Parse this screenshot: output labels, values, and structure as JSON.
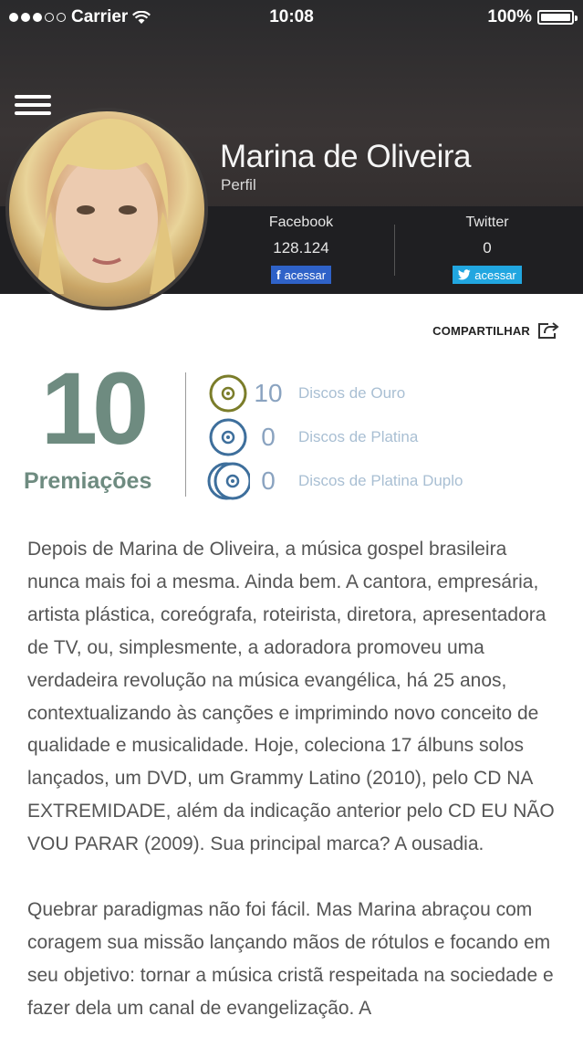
{
  "status_bar": {
    "carrier": "Carrier",
    "time": "10:08",
    "battery": "100%"
  },
  "profile": {
    "name": "Marina de Oliveira",
    "subtitle": "Perfil"
  },
  "social": {
    "facebook": {
      "label": "Facebook",
      "count": "128.124",
      "button": "acessar",
      "color": "#2f62c8"
    },
    "twitter": {
      "label": "Twitter",
      "count": "0",
      "button": "acessar",
      "color": "#21a6e0"
    }
  },
  "share_label": "COMPARTILHAR",
  "awards": {
    "total": "10",
    "label": "Premiações",
    "items": [
      {
        "count": "10",
        "label": "Discos de Ouro",
        "icon": "gold-disc-icon",
        "color": "#7b7d2a"
      },
      {
        "count": "0",
        "label": "Discos de Platina",
        "icon": "platinum-disc-icon",
        "color": "#3e6f9c"
      },
      {
        "count": "0",
        "label": "Discos de Platina Duplo",
        "icon": "double-platinum-disc-icon",
        "color": "#3e6f9c"
      }
    ]
  },
  "bio": {
    "paragraph1": "Depois de Marina de Oliveira, a música gospel brasileira nunca mais foi a mesma. Ainda bem. A cantora, empresária, artista plástica, coreógrafa, roteirista, diretora, apresentadora de TV, ou, simplesmente, a adoradora promoveu uma verdadeira revolução na música evangélica, há 25 anos, contextualizando às canções e imprimindo novo conceito de qualidade e musicalidade. Hoje, coleciona 17 álbuns solos lançados, um DVD, um Grammy Latino (2010), pelo CD NA EXTREMIDADE, além da indicação anterior pelo CD EU NÃO VOU PARAR (2009). Sua principal marca? A ousadia.",
    "paragraph2": "Quebrar paradigmas não foi fácil. Mas Marina abraçou com coragem sua missão lançando mãos de rótulos e focando em seu objetivo: tornar a música cristã respeitada na sociedade e fazer dela um canal de evangelização. A"
  }
}
